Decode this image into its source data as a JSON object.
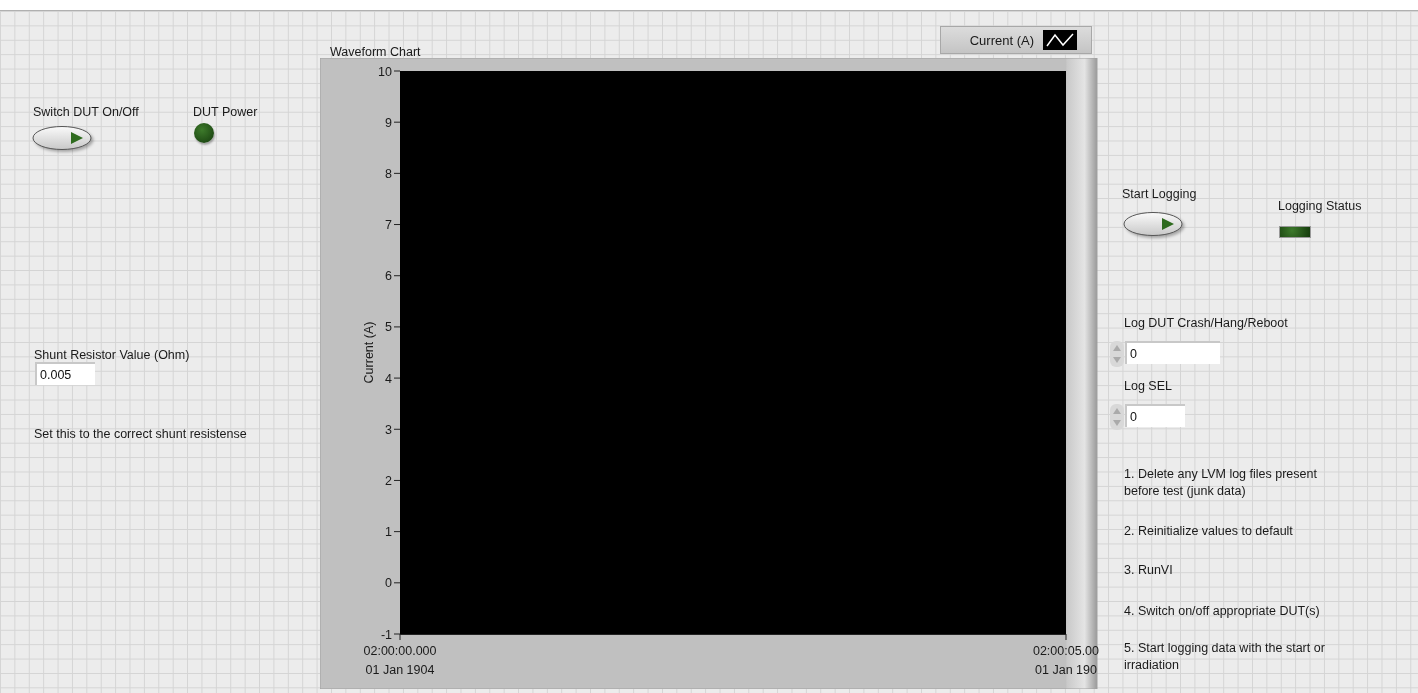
{
  "left_panel": {
    "power_switch": {
      "label": "Switch DUT On/Off",
      "on": false
    },
    "power_indicator": {
      "label": "DUT Power",
      "on": false
    },
    "shunt": {
      "label": "Shunt Resistor Value (Ohm)",
      "value": "0.005",
      "note": "Set this to the correct shunt resistense"
    }
  },
  "chart": {
    "chart_data": {
      "type": "line",
      "title": "Waveform Chart",
      "ylabel": "Current (A)",
      "ylim": [
        -1,
        10
      ],
      "yticks": [
        10,
        9,
        8,
        7,
        6,
        5,
        4,
        3,
        2,
        1,
        0,
        -1
      ],
      "categories": [
        "02:00:00.000",
        "02:00:05.00"
      ],
      "series": [
        {
          "name": "Current (A)",
          "color": "#ffffff",
          "values": [
            null,
            null
          ]
        }
      ]
    },
    "x_axis_dates": [
      "01 Jan 1904",
      "01 Jan 190"
    ]
  },
  "right_panel": {
    "logging_switch": {
      "label": "Start Logging",
      "on": false
    },
    "logging_indicator": {
      "label": "Logging Status",
      "on": false
    },
    "counters": [
      {
        "label": "Log DUT Crash/Hang/Reboot",
        "value": "0"
      },
      {
        "label": "Log SEL",
        "value": "0"
      }
    ],
    "instructions": [
      "1. Delete any LVM log files present before test (junk data)",
      "2. Reinitialize values to default",
      "3. RunVI",
      "4. Switch on/off appropriate DUT(s)",
      "5. Start logging data with the start or irradiation"
    ]
  }
}
